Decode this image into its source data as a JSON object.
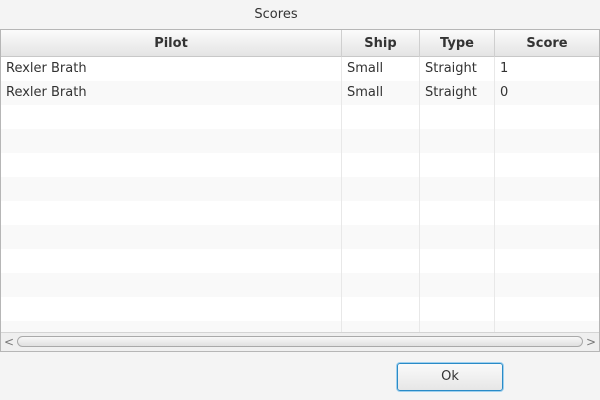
{
  "dialog": {
    "title": "Scores"
  },
  "table": {
    "columns": [
      "Pilot",
      "Ship",
      "Type",
      "Score"
    ],
    "rows": [
      [
        "Rexler Brath",
        "Small",
        "Straight",
        "1"
      ],
      [
        "Rexler Brath",
        "Small",
        "Straight",
        "0"
      ]
    ]
  },
  "scrollbar": {
    "left_arrow": "<",
    "right_arrow": ">"
  },
  "buttons": {
    "ok_label": "Ok"
  },
  "colors": {
    "focus_border": "#2a8bc7",
    "header_bg": "#e4e4e4"
  }
}
